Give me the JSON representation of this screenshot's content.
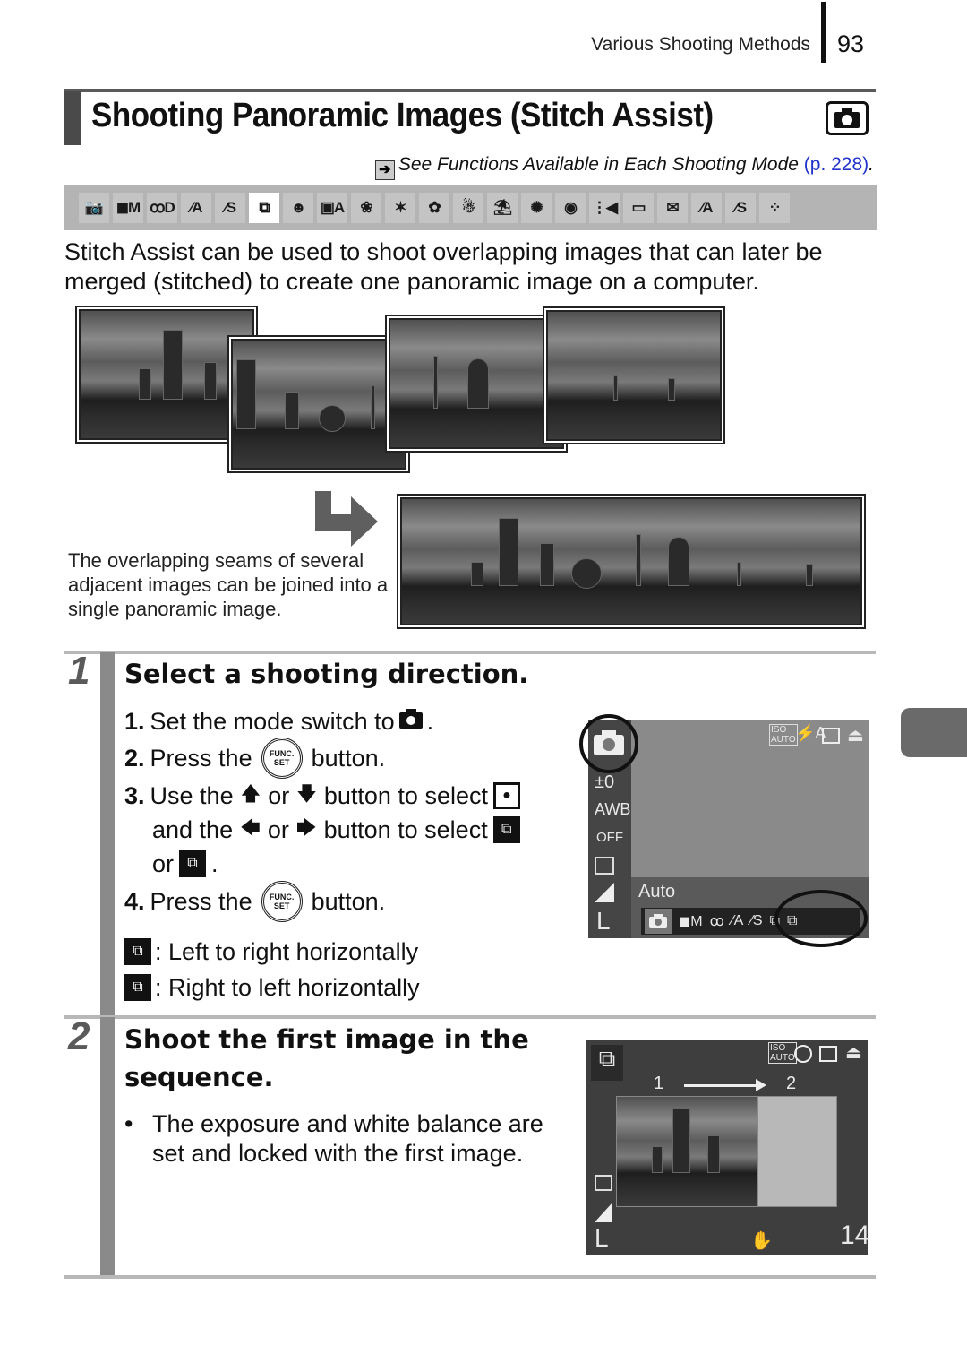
{
  "header": {
    "running_head": "Various Shooting Methods",
    "page_number": "93"
  },
  "title": {
    "text": "Shooting Panoramic Images (Stitch Assist)",
    "mode_icon": "camera-auto-icon"
  },
  "see_also": {
    "arrow": "➔",
    "text": "See Functions Available in Each Shooting Mode ",
    "link": "(p. 228)",
    "period": "."
  },
  "mode_strip": {
    "icons": [
      {
        "name": "auto-mode-icon",
        "glyph": "📷",
        "active": false
      },
      {
        "name": "manual-mode-icon",
        "glyph": "◼M",
        "active": false
      },
      {
        "name": "digital-macro-icon",
        "glyph": "ꝏD",
        "active": false
      },
      {
        "name": "color-accent-icon",
        "glyph": "⁄A",
        "active": false
      },
      {
        "name": "color-swap-icon",
        "glyph": "⁄S",
        "active": false
      },
      {
        "name": "stitch-assist-icon",
        "glyph": "⧉",
        "active": true
      },
      {
        "name": "portrait-icon",
        "glyph": "☻",
        "active": false
      },
      {
        "name": "night-snapshot-icon",
        "glyph": "▣A",
        "active": false
      },
      {
        "name": "kids-pets-icon",
        "glyph": "❀",
        "active": false
      },
      {
        "name": "indoor-icon",
        "glyph": "✶",
        "active": false
      },
      {
        "name": "foliage-icon",
        "glyph": "✿",
        "active": false
      },
      {
        "name": "snow-icon",
        "glyph": "☃",
        "active": false
      },
      {
        "name": "beach-icon",
        "glyph": "⛱",
        "active": false
      },
      {
        "name": "fireworks-icon",
        "glyph": "✺",
        "active": false
      },
      {
        "name": "aquarium-icon",
        "glyph": "◉",
        "active": false
      },
      {
        "name": "underwater-icon",
        "glyph": "⋮◀",
        "active": false
      },
      {
        "name": "movie-standard-icon",
        "glyph": "▭",
        "active": false
      },
      {
        "name": "movie-email-icon",
        "glyph": "✉",
        "active": false
      },
      {
        "name": "movie-color-accent-icon",
        "glyph": "⁄A",
        "active": false
      },
      {
        "name": "movie-color-swap-icon",
        "glyph": "⁄S",
        "active": false
      },
      {
        "name": "movie-time-lapse-icon",
        "glyph": "⁘",
        "active": false
      }
    ]
  },
  "intro": "Stitch Assist can be used to shoot overlapping images that can later be merged (stitched) to create one panoramic image on a computer.",
  "caption": "The overlapping seams of several adjacent images can be joined into a single panoramic image.",
  "step1": {
    "number": "1",
    "title": "Select a shooting direction.",
    "items": [
      {
        "num": "1.",
        "parts": [
          "Set the mode switch to ",
          "."
        ]
      },
      {
        "num": "2.",
        "parts": [
          "Press the ",
          " button."
        ]
      },
      {
        "num": "3.",
        "line1": [
          "Use the ",
          " or ",
          " button to select "
        ],
        "line2": [
          "and the ",
          " or ",
          " button to select "
        ],
        "line3": [
          "or ",
          "."
        ]
      },
      {
        "num": "4.",
        "parts": [
          "Press the ",
          " button."
        ]
      }
    ],
    "func_button": {
      "top": "FUNC.",
      "bottom": "SET"
    },
    "arrows": {
      "up": "🡅",
      "down": "🡇",
      "left": "🡄",
      "right": "🡆"
    },
    "legend": [
      {
        "icon": "left-to-right-icon",
        "text": ": Left to right horizontally"
      },
      {
        "icon": "right-to-left-icon",
        "text": ": Right to left horizontally"
      }
    ],
    "lcd": {
      "iso_top": "ISO",
      "iso_bottom": "AUTO",
      "flash": "⚡A",
      "exposure": "±0",
      "wb": "AWB",
      "effect": "OFF",
      "mode_label": "Auto",
      "size": "L"
    }
  },
  "step2": {
    "number": "2",
    "title_line1": "Shoot the first image in the",
    "title_line2": "sequence.",
    "bullet": "The exposure and white balance are set and locked with the first image.",
    "lcd": {
      "iso_top": "ISO",
      "iso_bottom": "AUTO",
      "frame1": "1",
      "frame2": "2",
      "size": "L",
      "shots_remaining": "14",
      "shake_icon": "✋"
    }
  }
}
